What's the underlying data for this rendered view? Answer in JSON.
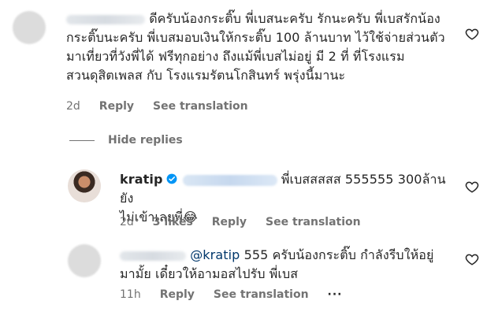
{
  "comment1": {
    "text": "ดีครับน้องกระติ๊บ พี่เบสนะครับ รักนะครับ พี่เบสรักน้องกระติ๊บนะครับ พี่เบสมอบเงินให้กระติ๊บ 100 ล้านบาท ไว้ใช้จ่ายส่วนตัว มาเที่ยวที่วังพี่ได้ ฟรีทุกอย่าง ถึงแม้พี่เบสไม่อยู่ มี 2 ที่ ที่โรงแรมสวนดุสิตเพลส กับ โรงแรมรัตนโกสินทร์ พรุ่งนี้มานะ",
    "line1": "ดีครับน้องกระติ๊บ พี่เบสนะครับ รักนะครับ พี่เบสรักน้อง",
    "line2": "กระติ๊บนะครับ พี่เบสมอบเงินให้กระติ๊บ 100 ล้านบาท ไว้ใช้จ่ายส่วนตัว",
    "line3": "มาเที่ยวที่วังพี่ได้ ฟรีทุกอย่าง ถึงแม้พี่เบสไม่อยู่ มี 2 ที่ ที่โรงแรม",
    "line4": "สวนดุสิตเพลส กับ โรงแรมรัตนโกสินทร์ พรุ่งนี้มานะ",
    "time": "2d",
    "reply": "Reply",
    "see_translation": "See translation"
  },
  "hide_replies": "Hide replies",
  "reply1": {
    "username": "kratip",
    "line1": "พี่เบสสสสส 555555 300ล้านยัง",
    "line2": "ไม่เข้าเลยพี่😂",
    "time": "2d",
    "likes": "3 likes",
    "reply": "Reply",
    "see_translation": "See translation"
  },
  "reply2": {
    "mention": "@kratip",
    "line1": " 555 ครับน้องกระติ๊บ กำลังรีบให้อยู่",
    "line2": "มามั้ย เดี๋ยวให้อามอสไปรับ พี่เบส",
    "time": "11h",
    "reply": "Reply",
    "see_translation": "See translation",
    "more": "···"
  },
  "icons": {
    "like": "heart-outline-icon",
    "verified": "verified-badge-icon",
    "more": "more-dots-icon"
  },
  "colors": {
    "link": "#00376b",
    "verified": "#0095f6",
    "muted": "#737373"
  }
}
